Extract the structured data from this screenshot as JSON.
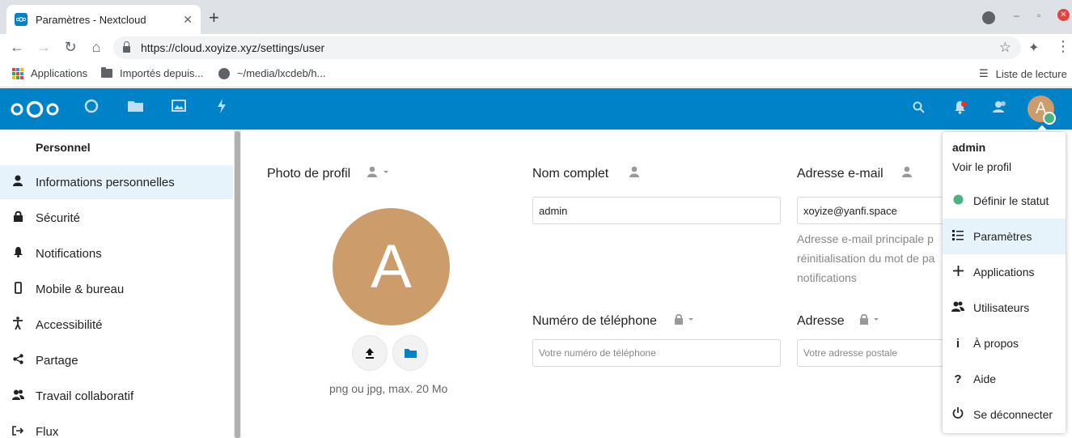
{
  "browser": {
    "tab_title": "Paramètres - Nextcloud",
    "url": "https://cloud.xoyize.xyz/settings/user",
    "bookmarks": [
      "Applications",
      "Importés depuis...",
      "~/media/lxcdeb/h..."
    ],
    "reading_list": "Liste de lecture"
  },
  "sidebar": {
    "caption": "Personnel",
    "items": [
      {
        "label": "Informations personnelles",
        "icon": "user-icon",
        "active": true
      },
      {
        "label": "Sécurité",
        "icon": "lock-icon"
      },
      {
        "label": "Notifications",
        "icon": "bell-icon"
      },
      {
        "label": "Mobile & bureau",
        "icon": "phone-icon"
      },
      {
        "label": "Accessibilité",
        "icon": "accessibility-icon"
      },
      {
        "label": "Partage",
        "icon": "share-icon"
      },
      {
        "label": "Travail collaboratif",
        "icon": "group-icon"
      },
      {
        "label": "Flux",
        "icon": "logout-icon"
      }
    ]
  },
  "profile": {
    "photo_title": "Photo de profil",
    "avatar_letter": "A",
    "photo_hint": "png ou jpg, max. 20 Mo",
    "fullname_title": "Nom complet",
    "fullname_value": "admin",
    "email_title": "Adresse e-mail",
    "email_value": "xoyize@yanfi.space",
    "email_help_1": "Adresse e-mail principale p",
    "email_help_2": "réinitialisation du mot de pa",
    "email_help_3": "notifications",
    "phone_title": "Numéro de téléphone",
    "phone_placeholder": "Votre numéro de téléphone",
    "address_title": "Adresse",
    "address_placeholder": "Votre adresse postale"
  },
  "user_menu": {
    "username": "admin",
    "view_profile": "Voir le profil",
    "items": [
      {
        "label": "Définir le statut",
        "icon": "status-dot-icon"
      },
      {
        "label": "Paramètres",
        "icon": "settings-list-icon",
        "active": true
      },
      {
        "label": "Applications",
        "icon": "plus-icon"
      },
      {
        "label": "Utilisateurs",
        "icon": "users-icon"
      },
      {
        "label": "À propos",
        "icon": "info-icon"
      },
      {
        "label": "Aide",
        "icon": "help-icon"
      },
      {
        "label": "Se déconnecter",
        "icon": "power-icon"
      }
    ]
  },
  "colors": {
    "brand": "#0082c9",
    "avatar": "#cd9c6b",
    "status_online": "#49b382"
  }
}
